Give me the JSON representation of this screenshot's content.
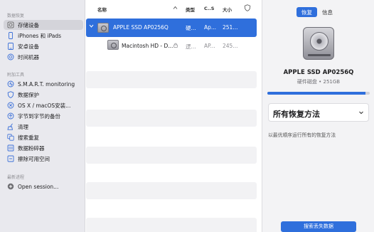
{
  "sidebar": {
    "section_recovery": "数据恢复",
    "section_tools": "附加工具",
    "section_recent": "最新进程",
    "recovery_items": [
      {
        "label": "存储设备",
        "icon": "hdd-icon"
      },
      {
        "label": "iPhones 和 iPads",
        "icon": "phone-icon"
      },
      {
        "label": "安卓设备",
        "icon": "android-icon"
      },
      {
        "label": "时间机器",
        "icon": "time-machine-icon"
      }
    ],
    "tool_items": [
      {
        "label": "S.M.A.R.T. monitoring",
        "icon": "smart-icon"
      },
      {
        "label": "数据保护",
        "icon": "shield-icon"
      },
      {
        "label": "OS X / macOS安装...",
        "icon": "installer-icon"
      },
      {
        "label": "字节到字节的备份",
        "icon": "backup-icon"
      },
      {
        "label": "清理",
        "icon": "broom-icon"
      },
      {
        "label": "搜索重复",
        "icon": "duplicate-icon"
      },
      {
        "label": "数据粉碎器",
        "icon": "shredder-icon"
      },
      {
        "label": "擦除可用空间",
        "icon": "erase-icon"
      }
    ],
    "recent_items": [
      {
        "label": "Open session...",
        "icon": "plus-icon"
      }
    ]
  },
  "list": {
    "columns": {
      "name": "名称",
      "type": "类型",
      "cs": "C..S",
      "size": "大小"
    },
    "rows": [
      {
        "name": "APPLE SSD AP0256Q",
        "type": "硬...",
        "cs": "Ap...",
        "size": "251..."
      },
      {
        "name": "Macintosh HD - D...",
        "type": "逻...",
        "cs": "AP...",
        "size": "245..."
      }
    ]
  },
  "panel": {
    "tab_recover": "恢复",
    "tab_info": "信息",
    "device_name": "APPLE SSD AP0256Q",
    "device_sub": "硬件磁盘 • 251GB",
    "usage_fraction": 0.96,
    "method_label": "所有恢复方法",
    "method_hint": "以最优顺序运行所有的恢复方法",
    "action_label": "搜索丢失数据"
  },
  "colors": {
    "accent": "#2f6fdc",
    "sidebar": "#e9e9ee",
    "selected": "#d4d4da"
  }
}
